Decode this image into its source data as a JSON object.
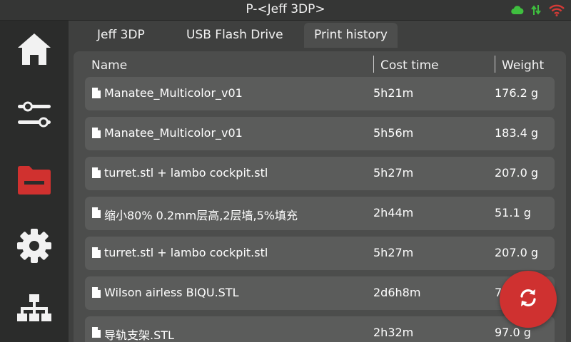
{
  "app": {
    "title": "P-<Jeff  3DP>"
  },
  "status": {
    "icons": [
      "cloud-icon",
      "transfer-arrows-icon",
      "wifi-icon"
    ],
    "cloud_color": "#3fbf3f",
    "wifi_color": "#d33a36"
  },
  "sidebar": {
    "items": [
      {
        "icon": "home-icon",
        "active": false
      },
      {
        "icon": "sliders-icon",
        "active": false
      },
      {
        "icon": "folder-icon",
        "active": true
      },
      {
        "icon": "gear-icon",
        "active": false
      },
      {
        "icon": "network-icon",
        "active": false
      }
    ],
    "accent_color": "#d0312f"
  },
  "tabs": [
    {
      "label": "Jeff  3DP",
      "active": false
    },
    {
      "label": "USB Flash Drive",
      "active": false
    },
    {
      "label": "Print history",
      "active": true
    }
  ],
  "table": {
    "columns": [
      "Name",
      "Cost time",
      "Weight"
    ],
    "rows": [
      {
        "name": "Manatee_Multicolor_v01",
        "cost": "5h21m",
        "weight": "176.2 g"
      },
      {
        "name": "Manatee_Multicolor_v01",
        "cost": "5h56m",
        "weight": "183.4 g"
      },
      {
        "name": "turret.stl + lambo cockpit.stl",
        "cost": "5h27m",
        "weight": "207.0 g"
      },
      {
        "name": "缩小80% 0.2mm层高,2层墙,5%填充",
        "cost": "2h44m",
        "weight": "51.1 g"
      },
      {
        "name": "turret.stl + lambo cockpit.stl",
        "cost": "5h27m",
        "weight": "207.0 g"
      },
      {
        "name": "Wilson airless BIQU.STL",
        "cost": "2d6h8m",
        "weight": "7"
      },
      {
        "name": "导轨支架.STL",
        "cost": "2h32m",
        "weight": "97.0 g"
      }
    ]
  },
  "refresh_button": {
    "icon": "refresh-icon",
    "color": "#cf3130"
  }
}
